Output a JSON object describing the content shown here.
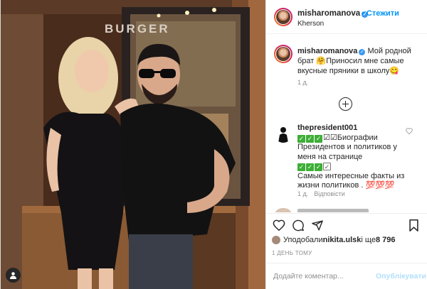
{
  "photo": {
    "sign_text": "BURGER",
    "alt": ""
  },
  "header": {
    "username": "misharomanova",
    "follow_label": "• Стежити",
    "location": "Kherson"
  },
  "caption": {
    "username": "misharomanova",
    "text": "Мой родной брат 🤗Приносил мне самые вкусные пряники в школу😋",
    "time": "1 д."
  },
  "comment": {
    "username": "thepresident001",
    "line1": "☑☑Биографии Президентов и политиков у меня на странице",
    "line2": "Самые интересные факты из жизни политиков . 💯💯💯",
    "time": "1 д.",
    "reply_label": "Відповісти"
  },
  "likes": {
    "prefix": "Уподобали ",
    "user": "nikita.ulsk",
    "middle": " і ще ",
    "count": "8 796"
  },
  "date": "1 ДЕНЬ ТОМУ",
  "add_comment": {
    "placeholder": "Додайте коментар...",
    "publish_label": "Опублікувати"
  },
  "colors": {
    "accent": "#0095f6",
    "muted": "#8e8e8e",
    "check_green": "#3dae36"
  },
  "icons": [
    "heart-icon",
    "comment-icon",
    "share-icon",
    "bookmark-icon",
    "plus-circle-icon",
    "user-tag-icon",
    "verified-icon"
  ]
}
